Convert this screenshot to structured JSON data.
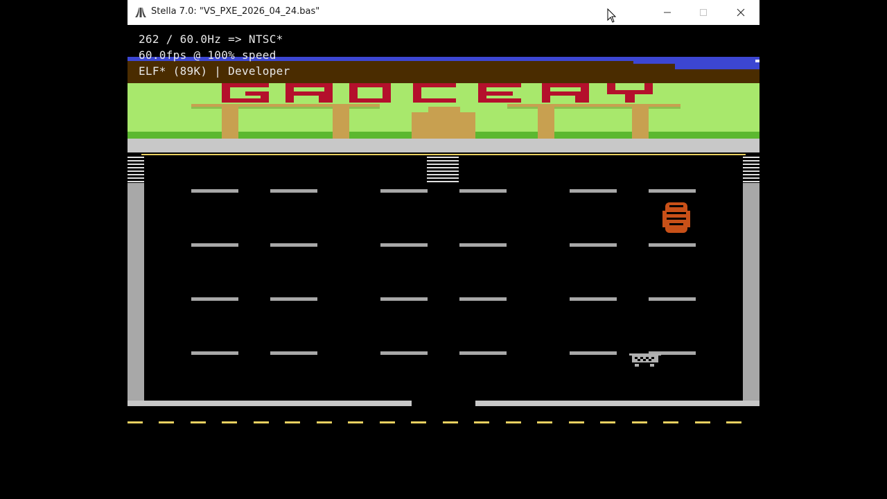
{
  "window": {
    "title": "Stella 7.0: \"VS_PXE_2026_04_24.bas\"",
    "app_icon": "atari-fuji-icon",
    "controls": [
      "minimize-icon",
      "maximize-icon",
      "close-icon"
    ]
  },
  "osd": {
    "line1": "262 / 60.0Hz => NTSC*",
    "line2": "60.0fps @ 100% speed",
    "line3": "ELF* (89K) | Developer"
  },
  "game": {
    "sign_text": "GROCERY",
    "colors": {
      "sky": "#3c46d2",
      "roof": "#4a2c00",
      "grass": "#a8e86c",
      "sign": "#b4102c",
      "pillar": "#c8a050",
      "sidewalk": "#c8c8c8",
      "shelf": "#a8a8a8",
      "road_line": "#e8d060",
      "player": "#c85018"
    }
  }
}
